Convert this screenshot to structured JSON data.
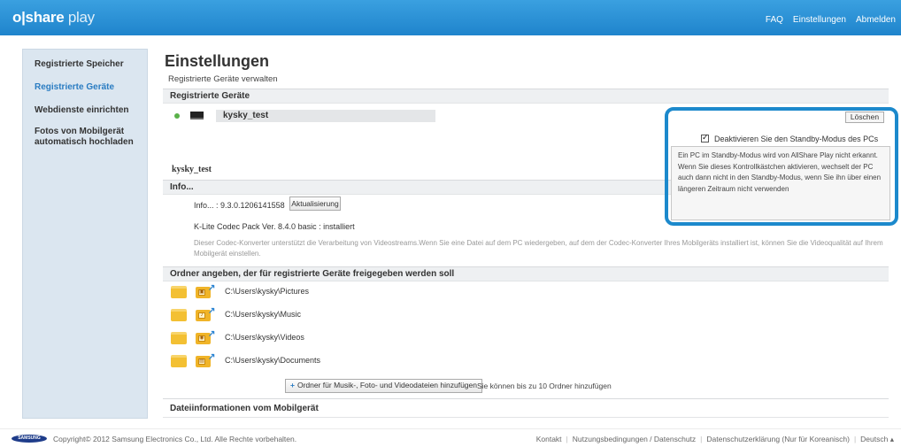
{
  "header": {
    "logo_main": "o|share",
    "logo_play": " play",
    "nav": [
      "FAQ",
      "Einstellungen",
      "Abmelden"
    ]
  },
  "sidebar": {
    "items": [
      {
        "label": "Registrierte Speicher",
        "active": false
      },
      {
        "label": "Registrierte Geräte",
        "active": true
      },
      {
        "label": "Webdienste einrichten",
        "active": false
      },
      {
        "label": "Fotos von Mobilgerät automatisch hochladen",
        "active": false
      }
    ]
  },
  "main": {
    "title": "Einstellungen",
    "subtitle": "Registrierte Geräte verwalten",
    "section_devices": "Registrierte Geräte",
    "device_name": "kysky_test",
    "delete_label": "Löschen",
    "standby_label": "Deaktivieren Sie den Standby-Modus des PCs",
    "standby_checked": true,
    "tooltip_text": "Ein PC im Standby-Modus wird von AllShare Play nicht erkannt. Wenn Sie dieses Kontrollkästchen aktivieren, wechselt der PC auch dann nicht in den Standby-Modus, wenn Sie ihn über einen längeren Zeitraum nicht verwenden",
    "device_heading": "kysky_test",
    "section_info": "Info...",
    "info_version": "Info... : 9.3.0.1206141558",
    "update_label": "Aktualisierung",
    "codec_line": "K-Lite Codec Pack Ver. 8.4.0 basic : installiert",
    "codec_desc": "Dieser Codec-Konverter unterstützt die Verarbeitung von Videostreams.Wenn Sie eine Datei auf dem PC wiedergeben, auf dem der Codec-Konverter Ihres Mobilgeräts installiert ist, können Sie die Videoqualität auf Ihrem Mobilgerät einstellen.",
    "section_folders": "Ordner angeben, der für registrierte Geräte freigegeben werden soll",
    "folders": [
      {
        "path": "C:\\Users\\kysky\\Pictures",
        "icon": "picture-folder-icon"
      },
      {
        "path": "C:\\Users\\kysky\\Music",
        "icon": "music-folder-icon"
      },
      {
        "path": "C:\\Users\\kysky\\Videos",
        "icon": "video-folder-icon"
      },
      {
        "path": "C:\\Users\\kysky\\Documents",
        "icon": "document-folder-icon"
      }
    ],
    "add_folder_label": "Ordner für Musik-, Foto- und Videodateien hinzufügen",
    "add_folder_note": "Sie können bis zu 10 Ordner hinzufügen",
    "section_mobile": "Dateiinformationen vom Mobilgerät"
  },
  "footer": {
    "brand": "SAMSUNG",
    "copyright": "Copyright© 2012 Samsung Electronics Co., Ltd. Alle Rechte vorbehalten.",
    "links": [
      "Kontakt",
      "Nutzungsbedingungen / Datenschutz",
      "Datenschutzerklärung (Nur für Koreanisch)",
      "Deutsch"
    ]
  },
  "colors": {
    "header_blue": "#1f84cc",
    "accent_link": "#2a7cc2",
    "callout_border": "#1c89cc",
    "online_green": "#5ab14a",
    "folder_yellow": "#f3c033"
  }
}
